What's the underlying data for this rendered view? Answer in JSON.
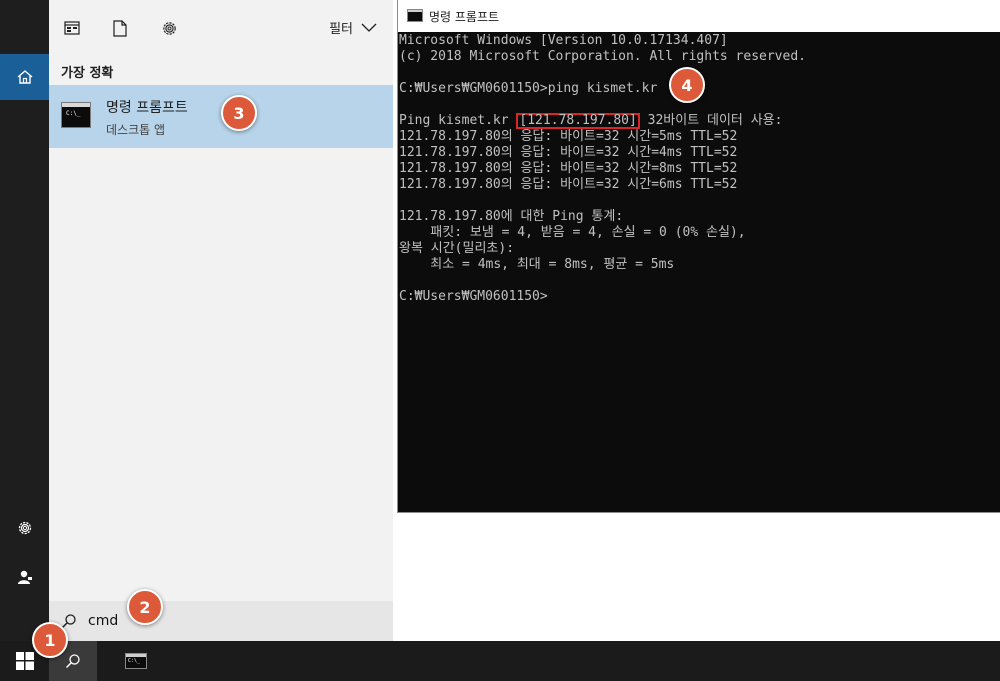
{
  "start_menu": {
    "filter_label": "필터",
    "section_title": "가장 정확",
    "best_match": {
      "title": "명령 프롬프트",
      "subtitle": "데스크톱 앱",
      "icon_glyph": "C:\\_"
    },
    "search_query": "cmd"
  },
  "console": {
    "window_title": "명령 프롬프트",
    "lines": [
      "Microsoft Windows [Version 10.0.17134.407]",
      "(c) 2018 Microsoft Corporation. All rights reserved.",
      "",
      "C:₩Users₩GM0601150>ping kismet.kr",
      "",
      "",
      "121.78.197.80의 응답: 바이트=32 시간=5ms TTL=52",
      "121.78.197.80의 응답: 바이트=32 시간=4ms TTL=52",
      "121.78.197.80의 응답: 바이트=32 시간=8ms TTL=52",
      "121.78.197.80의 응답: 바이트=32 시간=6ms TTL=52",
      "",
      "121.78.197.80에 대한 Ping 통계:",
      "    패킷: 보냄 = 4, 받음 = 4, 손실 = 0 (0% 손실),",
      "왕복 시간(밀리초):",
      "    최소 = 4ms, 최대 = 8ms, 평균 = 5ms",
      "",
      "C:₩Users₩GM0601150>"
    ],
    "ping_line": {
      "prefix": "Ping kismet.kr ",
      "ip": "[121.78.197.80]",
      "suffix": " 32바이트 데이터 사용:"
    }
  },
  "markers": [
    "1",
    "2",
    "3",
    "4"
  ],
  "colors": {
    "marker": "#dc5a3a",
    "highlight_box": "#d8262a",
    "best_match_bg": "#b7d4ea",
    "rail_home": "#1b5f99"
  }
}
